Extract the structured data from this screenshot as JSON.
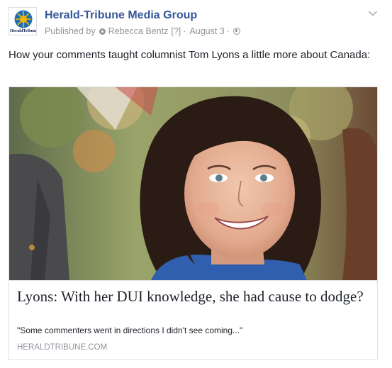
{
  "post": {
    "page_name": "Herald-Tribune Media Group",
    "avatar_text": "HeraldTribune",
    "published_by_prefix": "Published by",
    "author": "Rebecca Bentz",
    "author_help": "[?]",
    "separator": "·",
    "date": "August 3",
    "text": "How your comments taught columnist Tom Lyons a little more about Canada:",
    "icons": {
      "author_icon": "gear-icon",
      "privacy_icon": "globe-icon",
      "menu_icon": "chevron-down-icon"
    }
  },
  "link_card": {
    "title": "Lyons: With her DUI knowledge, she had cause to dodge?",
    "description": "\"Some commenters went in directions I didn't see coming...\"",
    "domain": "HERALDTRIBUNE.COM"
  },
  "colors": {
    "page_name": "#365899",
    "meta": "#90949c",
    "text": "#1d2129",
    "border": "#dddfe2",
    "logo_sun": "#f2b705",
    "logo_blue": "#1f6fb5"
  }
}
